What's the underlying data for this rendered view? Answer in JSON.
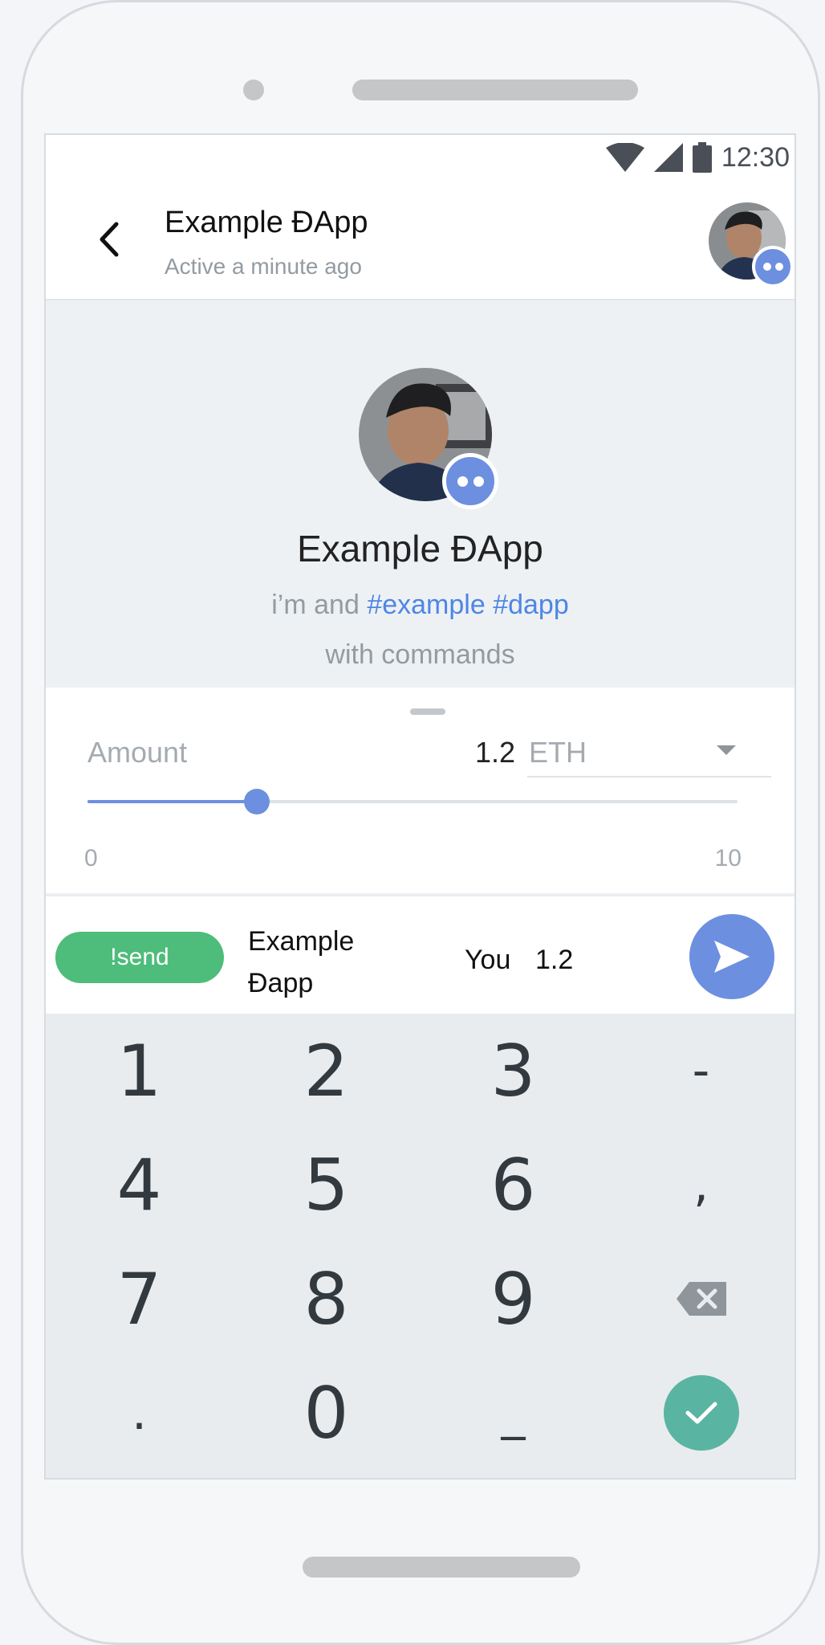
{
  "status_bar": {
    "time": "12:30",
    "icons": [
      "wifi-icon",
      "signal-icon",
      "battery-icon"
    ]
  },
  "header": {
    "title": "Example ĐApp",
    "subtitle": "Active a minute ago"
  },
  "intro": {
    "name": "Example ĐApp",
    "desc_prefix": "i’m and",
    "tag1": "#example",
    "tag2": "#dapp",
    "desc_line2": "with commands"
  },
  "amount": {
    "label": "Amount",
    "value": "1.2",
    "currency": "ETH",
    "slider_min": "0",
    "slider_max": "10",
    "slider_value": 2.6
  },
  "command": {
    "pill": "!send",
    "target": "Example Đapp",
    "you": "You",
    "amount": "1.2"
  },
  "keypad": {
    "keys": [
      "1",
      "2",
      "3",
      "-",
      "4",
      "5",
      "6",
      ",",
      "7",
      "8",
      "9",
      ".",
      "0",
      "_"
    ]
  },
  "colors": {
    "accent": "#6d8fe0",
    "command_green": "#4ebc7a",
    "done_teal": "#5ab4a2",
    "tag_blue": "#4e86e4"
  }
}
